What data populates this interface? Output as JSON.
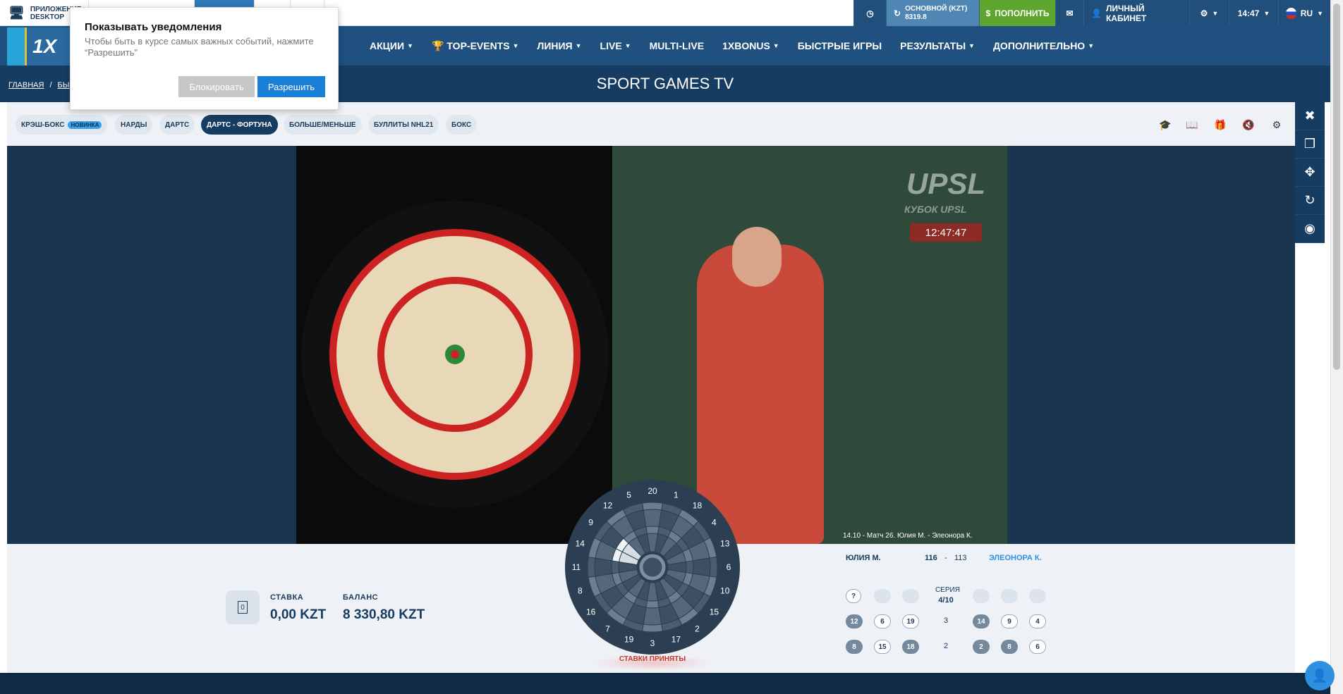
{
  "topbar": {
    "app_label_1": "ПРИЛОЖЕНИЕ",
    "app_label_2": "DESKTOP",
    "account_type": "ОСНОВНОЙ (KZT)",
    "account_balance": "8319.8",
    "deposit": "ПОПОЛНИТЬ",
    "cabinet": "ЛИЧНЫЙ КАБИНЕТ",
    "time": "14:47",
    "lang": "RU"
  },
  "nav": {
    "items": [
      "АКЦИИ",
      "TOP-EVENTS",
      "ЛИНИЯ",
      "LIVE",
      "MULTI-LIVE",
      "1XBONUS",
      "БЫСТРЫЕ ИГРЫ",
      "РЕЗУЛЬТАТЫ",
      "ДОПОЛНИТЕЛЬНО"
    ]
  },
  "breadcrumb": {
    "home": "ГЛАВНАЯ",
    "second": "БЫ"
  },
  "page_title": "SPORT GAMES TV",
  "game_tabs": [
    {
      "label": "КРЭШ-БОКС",
      "badge": "НОВИНКА"
    },
    {
      "label": "НАРДЫ"
    },
    {
      "label": "ДАРТС"
    },
    {
      "label": "ДАРТС - ФОРТУНА",
      "active": true
    },
    {
      "label": "БОЛЬШЕ/МЕНЬШЕ"
    },
    {
      "label": "БУЛЛИТЫ NHL21"
    },
    {
      "label": "БОКС"
    }
  ],
  "video": {
    "timer": "12:47:47",
    "caption": "14.10 - Матч 26. Юлия М. - Элеонора К.",
    "logo": "UPSL",
    "logo_sub": "КУБОК UPSL"
  },
  "bet": {
    "stake_icon_text": "0",
    "stake_label": "СТАВКА",
    "stake_value": "0,00 KZT",
    "balance_label": "БАЛАНС",
    "balance_value": "8 330,80 KZT"
  },
  "dartboard": {
    "numbers": [
      "20",
      "1",
      "18",
      "4",
      "13",
      "6",
      "10",
      "15",
      "2",
      "17",
      "3",
      "19",
      "7",
      "16",
      "8",
      "11",
      "14",
      "9",
      "12",
      "5"
    ],
    "status": "СТАВКИ ПРИНЯТЫ"
  },
  "scoreboard": {
    "player1": "ЮЛИЯ М.",
    "score1": "116",
    "sep": "-",
    "score2": "113",
    "player2": "ЭЛЕОНОРА К.",
    "series_label": "СЕРИЯ",
    "series_value": "4/10",
    "help": "?",
    "rows": [
      {
        "num": "3",
        "p1": [
          "12",
          "6",
          "19"
        ],
        "p2": [
          "14",
          "9",
          "4"
        ]
      },
      {
        "num": "2",
        "p1": [
          "8",
          "15",
          "18"
        ],
        "p2": [
          "2",
          "8",
          "6"
        ]
      }
    ]
  },
  "popup": {
    "title": "Показывать уведомления",
    "text": "Чтобы быть в курсе самых важных событий, нажмите “Разрешить”",
    "block": "Блокировать",
    "allow": "Разрешить"
  }
}
